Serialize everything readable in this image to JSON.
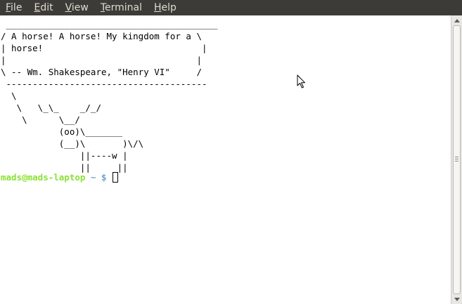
{
  "menubar": {
    "items": [
      {
        "label": "File",
        "mnemonic": "F",
        "rest": "ile"
      },
      {
        "label": "Edit",
        "mnemonic": "E",
        "rest": "dit"
      },
      {
        "label": "View",
        "mnemonic": "V",
        "rest": "iew"
      },
      {
        "label": "Terminal",
        "mnemonic": "T",
        "rest": "erminal"
      },
      {
        "label": "Help",
        "mnemonic": "H",
        "rest": "elp"
      }
    ]
  },
  "terminal": {
    "output": " ________________________________________\n/ A horse! A horse! My kingdom for a \\\n| horse!                              |\n|                                    |\n\\ -- Wm. Shakespeare, \"Henry VI\"     /\n --------------------------------------\n  \\\n   \\   \\_\\_    _/_/\n    \\      \\__/\n           (oo)\\_______\n           (__)\\       )\\/\\\n               ||----w |\n               ||     ||",
    "prompt_user": "mads@mads-laptop",
    "prompt_path": " ~ $ ",
    "colors": {
      "user": "#8ae234",
      "path": "#729fcf",
      "background": "#ffffff",
      "text": "#000000"
    }
  },
  "icons": {
    "pointer": "mouse-pointer-icon",
    "scroll_up": "chevron-up-icon",
    "scroll_down": "chevron-down-icon"
  }
}
